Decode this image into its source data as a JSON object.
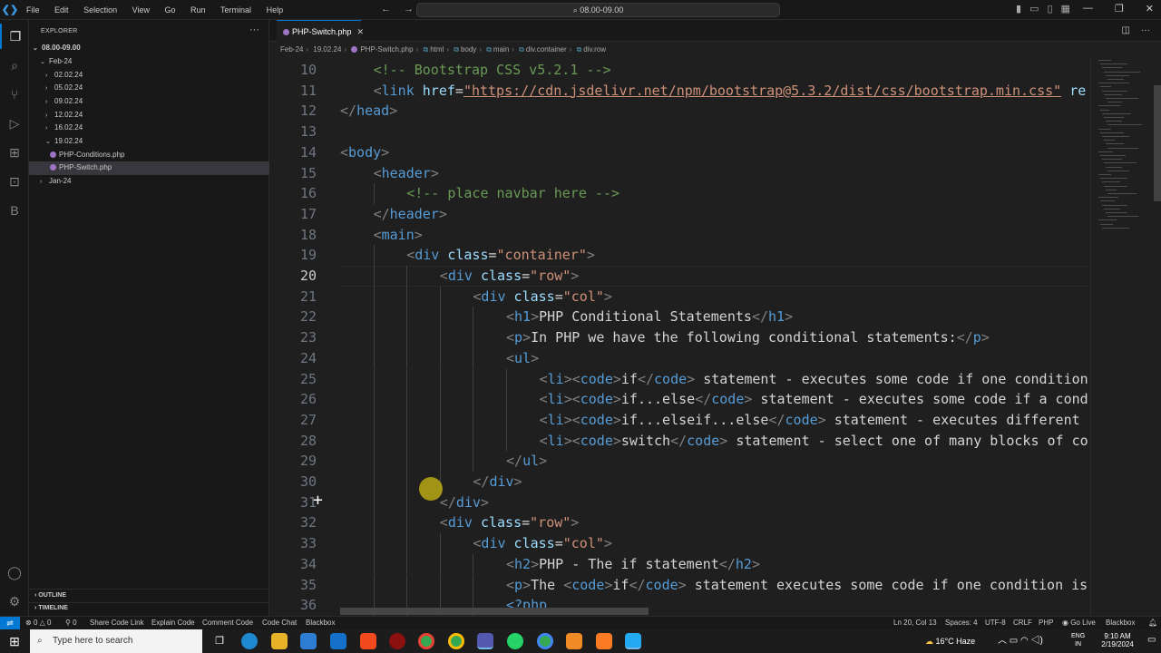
{
  "titlebar": {
    "menu": [
      "File",
      "Edit",
      "Selection",
      "View",
      "Go",
      "Run",
      "Terminal",
      "Help"
    ],
    "search_text": "08.00-09.00"
  },
  "sidebar": {
    "title": "EXPLORER",
    "root": "08.00-09.00",
    "items": [
      {
        "label": "Feb-24",
        "expanded": true
      },
      {
        "label": "02.02.24"
      },
      {
        "label": "05.02.24"
      },
      {
        "label": "09.02.24"
      },
      {
        "label": "12.02.24"
      },
      {
        "label": "16.02.24"
      },
      {
        "label": "19.02.24",
        "expanded": true
      },
      {
        "label": "PHP-Conditions.php",
        "file": true
      },
      {
        "label": "PHP-Switch.php",
        "file": true,
        "selected": true
      },
      {
        "label": "Jan-24"
      }
    ],
    "outline": "OUTLINE",
    "timeline": "TIMELINE"
  },
  "tab": {
    "label": "PHP-Switch.php"
  },
  "breadcrumb": [
    "Feb-24",
    "19.02.24",
    "PHP-Switch.php",
    "html",
    "body",
    "main",
    "div.container",
    "div.row"
  ],
  "editor": {
    "current_line": 20,
    "lines": [
      {
        "n": "10",
        "indent": 1
      },
      {
        "n": "11",
        "indent": 1
      },
      {
        "n": "12",
        "indent": 0
      },
      {
        "n": "13",
        "indent": 0
      },
      {
        "n": "14",
        "indent": 0
      },
      {
        "n": "15",
        "indent": 1
      },
      {
        "n": "16",
        "indent": 2
      },
      {
        "n": "17",
        "indent": 1
      },
      {
        "n": "18",
        "indent": 1
      },
      {
        "n": "19",
        "indent": 2
      },
      {
        "n": "20",
        "indent": 3
      },
      {
        "n": "21",
        "indent": 4
      },
      {
        "n": "22",
        "indent": 5
      },
      {
        "n": "23",
        "indent": 5
      },
      {
        "n": "24",
        "indent": 5
      },
      {
        "n": "25",
        "indent": 6
      },
      {
        "n": "26",
        "indent": 6
      },
      {
        "n": "27",
        "indent": 6
      },
      {
        "n": "28",
        "indent": 6
      },
      {
        "n": "29",
        "indent": 5
      },
      {
        "n": "30",
        "indent": 4
      },
      {
        "n": "31",
        "indent": 3
      },
      {
        "n": "32",
        "indent": 3
      },
      {
        "n": "33",
        "indent": 4
      },
      {
        "n": "34",
        "indent": 5
      },
      {
        "n": "35",
        "indent": 5
      },
      {
        "n": "36",
        "indent": 5
      }
    ],
    "text": {
      "l10": "<!-- Bootstrap CSS v5.2.1 -->",
      "l11_tag": "link",
      "l11_attr": "href",
      "l11_url": "\"https://cdn.jsdelivr.net/npm/bootstrap@5.3.2/dist/css/bootstrap.min.css\"",
      "l11_rest": "re",
      "l12": "head",
      "l14": "body",
      "l15": "header",
      "l16": "<!-- place navbar here -->",
      "l17": "header",
      "l18": "main",
      "div": "div",
      "class": "class",
      "l19_val": "\"container\"",
      "row_val": "\"row\"",
      "col_val": "\"col\"",
      "h1": "h1",
      "l22_text": "PHP Conditional Statements",
      "p": "p",
      "l23_text": "In PHP we have the following conditional statements:",
      "ul": "ul",
      "li": "li",
      "code": "code",
      "l25_code": "if",
      "l25_text": " statement - executes some code if one condition",
      "l26_code": "if...else",
      "l26_text": " statement - executes some code if a cond",
      "l27_code": "if...elseif...else",
      "l27_text": " statement - executes different",
      "l28_code": "switch",
      "l28_text": " statement - select one of many blocks of co",
      "h2": "h2",
      "l34_text": "PHP - The if statement",
      "l35_text_a": "The ",
      "l35_code": "if",
      "l35_text_b": " statement executes some code if one condition is",
      "l36": "<?php"
    }
  },
  "statusbar": {
    "errors": "0",
    "warnings": "0",
    "ports": "0",
    "left_items": [
      "Share Code Link",
      "Explain Code",
      "Comment Code",
      "Code Chat",
      "Blackbox"
    ],
    "position": "Ln 20, Col 13",
    "spaces": "Spaces: 4",
    "encoding": "UTF-8",
    "eol": "CRLF",
    "language": "PHP",
    "golive": "Go Live",
    "blackbox": "Blackbox"
  },
  "taskbar": {
    "search_placeholder": "Type here to search",
    "weather": "16°C  Haze",
    "lang_top": "ENG",
    "lang_bottom": "IN",
    "time": "9:10 AM",
    "date": "2/19/2024"
  },
  "colors": {
    "accent": "#0078d4",
    "tag": "#569cd6",
    "attr": "#9cdcfe",
    "string": "#ce9178",
    "comment": "#6a9955"
  }
}
